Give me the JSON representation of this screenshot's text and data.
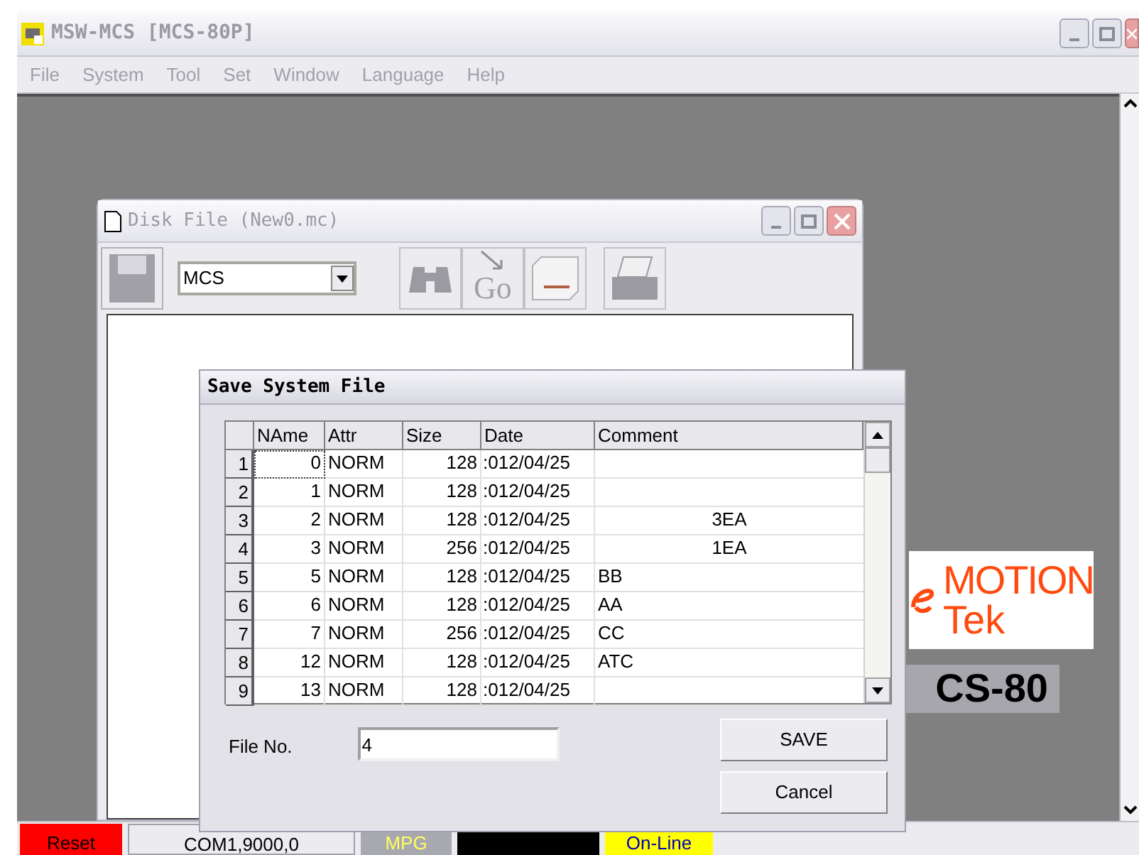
{
  "app": {
    "title": "MSW-MCS [MCS-80P]"
  },
  "menu": [
    "File",
    "System",
    "Tool",
    "Set",
    "Window",
    "Language",
    "Help"
  ],
  "logo": {
    "line_1": "MOTION",
    "line_2": "Tek",
    "model": "CS-80"
  },
  "disk_window": {
    "title": "Disk File (New0.mc)",
    "type_select": "MCS",
    "tools": [
      {
        "kind": "save"
      },
      {
        "kind": "find"
      },
      {
        "kind": "go",
        "label": "Go"
      },
      {
        "kind": "drive"
      },
      {
        "kind": "print"
      }
    ]
  },
  "dialog": {
    "title": "Save System File",
    "columns": [
      "NAme",
      "Attr",
      "Size",
      "Date",
      "Comment"
    ],
    "rows": [
      {
        "index": "1",
        "name": "0",
        "attr": "NORM",
        "size": "128",
        "date": ":012/04/25",
        "comment": "",
        "kind": "plain",
        "focused": true
      },
      {
        "index": "2",
        "name": "1",
        "attr": "NORM",
        "size": "128",
        "date": ":012/04/25",
        "comment": "",
        "kind": "plain",
        "focused": false
      },
      {
        "index": "3",
        "name": "2",
        "attr": "NORM",
        "size": "128",
        "date": ":012/04/25",
        "comment": "3EA",
        "kind": "centered",
        "focused": false
      },
      {
        "index": "4",
        "name": "3",
        "attr": "NORM",
        "size": "256",
        "date": ":012/04/25",
        "comment": "1EA",
        "kind": "centered",
        "focused": false
      },
      {
        "index": "5",
        "name": "5",
        "attr": "NORM",
        "size": "128",
        "date": ":012/04/25",
        "comment": "BB",
        "kind": "plain",
        "focused": false
      },
      {
        "index": "6",
        "name": "6",
        "attr": "NORM",
        "size": "128",
        "date": ":012/04/25",
        "comment": "AA",
        "kind": "plain",
        "focused": false
      },
      {
        "index": "7",
        "name": "7",
        "attr": "NORM",
        "size": "256",
        "date": ":012/04/25",
        "comment": "CC",
        "kind": "plain",
        "focused": false
      },
      {
        "index": "8",
        "name": "12",
        "attr": "NORM",
        "size": "128",
        "date": ":012/04/25",
        "comment": "ATC",
        "kind": "plain",
        "focused": false
      },
      {
        "index": "9",
        "name": "13",
        "attr": "NORM",
        "size": "128",
        "date": ":012/04/25",
        "comment": "",
        "kind": "plain",
        "focused": false
      }
    ],
    "file_no_label": "File No.",
    "file_no": "4",
    "buttons": [
      "SAVE",
      "Cancel"
    ]
  },
  "status_bar": [
    {
      "kind": "alarm",
      "text": "Reset"
    },
    {
      "kind": "plain",
      "text": "COM1,9000,0"
    },
    {
      "kind": "dim",
      "text": "MPG"
    },
    {
      "kind": "blank"
    },
    {
      "kind": "online",
      "text": "On-Line"
    }
  ]
}
